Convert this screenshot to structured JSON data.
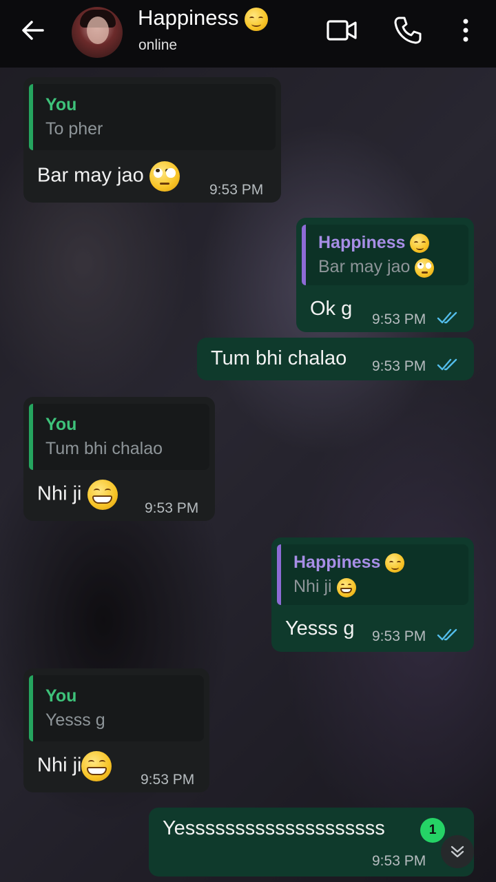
{
  "header": {
    "contact_name": "Happiness",
    "contact_status": "online",
    "icons": [
      "back-arrow-icon",
      "video-call-icon",
      "voice-call-icon",
      "more-vert-icon"
    ]
  },
  "messages": [
    {
      "dir": "in",
      "quote_author": "You",
      "quote_text": "To pher",
      "text": "Bar may jao",
      "time": "9:53 PM"
    },
    {
      "dir": "out",
      "quote_author": "Happiness",
      "quote_text": "Bar may jao",
      "text": "Ok g",
      "time": "9:53 PM"
    },
    {
      "dir": "out",
      "text": "Tum bhi chalao",
      "time": "9:53 PM"
    },
    {
      "dir": "in",
      "quote_author": "You",
      "quote_text": "Tum bhi chalao",
      "text": "Nhi ji",
      "time": "9:53 PM"
    },
    {
      "dir": "out",
      "quote_author": "Happiness",
      "quote_text": "Nhi ji",
      "text": "Yesss g",
      "time": "9:53 PM"
    },
    {
      "dir": "in",
      "quote_author": "You",
      "quote_text": "Yesss g",
      "text": "Nhi ji",
      "time": "9:53 PM"
    },
    {
      "dir": "out",
      "text": "Yessssssssssssssssssss",
      "time": "9:53 PM"
    }
  ],
  "unread_count": "1",
  "colors": {
    "header_bg": "#0b0b0d",
    "incoming_bubble": "#1c1e1f",
    "outgoing_bubble": "#0f3a2c",
    "you_quote_accent": "#3ec27a",
    "happiness_quote_accent": "#a78ee6",
    "read_ticks": "#53bdeb",
    "badge": "#25d366"
  }
}
